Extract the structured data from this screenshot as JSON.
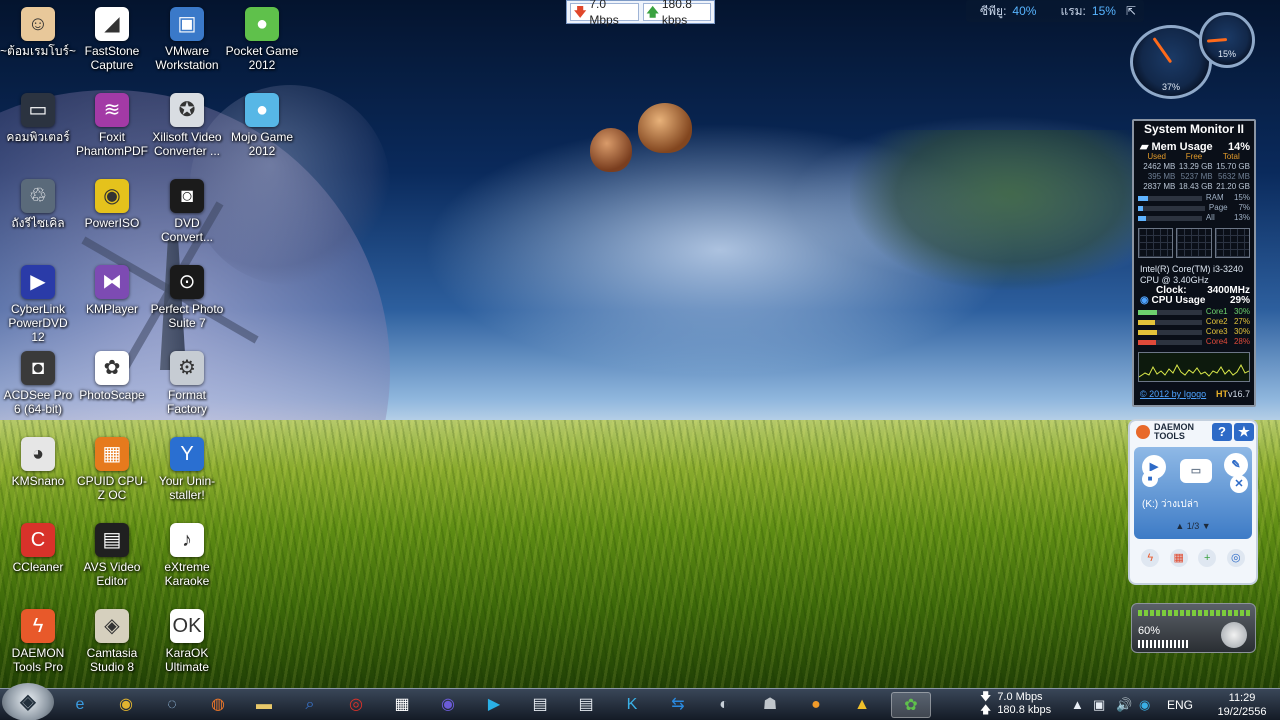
{
  "desktop": {
    "icons": [
      {
        "label": "~ต้อมเรมโบร์~",
        "icon": "user-avatar-icon",
        "bg": "#e8c89a",
        "glyph": "☺"
      },
      {
        "label": "FastStone Capture",
        "icon": "faststone-capture-icon",
        "bg": "#ffffff",
        "glyph": "◢"
      },
      {
        "label": "VMware Workstation",
        "icon": "vmware-icon",
        "bg": "#3a79c9",
        "glyph": "▣"
      },
      {
        "label": "Pocket Game 2012",
        "icon": "mushroom-icon",
        "bg": "#5fc14b",
        "glyph": "●"
      },
      {
        "label": "คอมพิวเตอร์",
        "icon": "computer-icon",
        "bg": "#2b3340",
        "glyph": "▭"
      },
      {
        "label": "Foxit PhantomPDF",
        "icon": "foxit-pdf-icon",
        "bg": "#a33aa6",
        "glyph": "≋"
      },
      {
        "label": "Xilisoft Video Converter ...",
        "icon": "film-reel-icon",
        "bg": "#d9dde2",
        "glyph": "✪"
      },
      {
        "label": "Mojo Game 2012",
        "icon": "mushroom-blue-icon",
        "bg": "#57b7e6",
        "glyph": "●"
      },
      {
        "label": "ถังรีไซเคิล",
        "icon": "recycle-bin-icon",
        "bg": "#5a6a7a",
        "glyph": "♲"
      },
      {
        "label": "PowerISO",
        "icon": "disc-icon",
        "bg": "#e5c21c",
        "glyph": "◉"
      },
      {
        "label": "DVD Convert...",
        "icon": "dvd-icon",
        "bg": "#1b1b1b",
        "glyph": "◙"
      },
      {
        "label": "CyberLink PowerDVD 12",
        "icon": "powerdvd-icon",
        "bg": "#2a3ba8",
        "glyph": "▶"
      },
      {
        "label": "KMPlayer",
        "icon": "kmplayer-icon",
        "bg": "#7d4bb3",
        "glyph": "⧓"
      },
      {
        "label": "Perfect Photo Suite 7",
        "icon": "on1-icon",
        "bg": "#1a1a1a",
        "glyph": "⊙"
      },
      {
        "label": "ACDSee Pro 6 (64-bit)",
        "icon": "camera-icon",
        "bg": "#3a3a3a",
        "glyph": "◘"
      },
      {
        "label": "PhotoScape",
        "icon": "photoscape-icon",
        "bg": "#ffffff",
        "glyph": "✿"
      },
      {
        "label": "Format Factory",
        "icon": "format-factory-icon",
        "bg": "#c6ccd3",
        "glyph": "⚙"
      },
      {
        "label": "KMSnano",
        "icon": "kmsnano-icon",
        "bg": "#e6e6e6",
        "glyph": "◕"
      },
      {
        "label": "CPUID CPU-Z OC",
        "icon": "cpuz-icon",
        "bg": "#e67a1d",
        "glyph": "▦"
      },
      {
        "label": "Your Unin-staller!",
        "icon": "uninstaller-icon",
        "bg": "#2a6fd1",
        "glyph": "Y"
      },
      {
        "label": "CCleaner",
        "icon": "ccleaner-icon",
        "bg": "#d8322a",
        "glyph": "C"
      },
      {
        "label": "AVS Video Editor",
        "icon": "avs-video-icon",
        "bg": "#202020",
        "glyph": "▤"
      },
      {
        "label": "eXtreme Karaoke",
        "icon": "karaoke-icon",
        "bg": "#ffffff",
        "glyph": "♪"
      },
      {
        "label": "DAEMON Tools Pro",
        "icon": "daemon-tools-icon",
        "bg": "#e8592a",
        "glyph": "ϟ"
      },
      {
        "label": "Camtasia Studio 8",
        "icon": "camtasia-icon",
        "bg": "#d6d0be",
        "glyph": "◈"
      },
      {
        "label": "KaraOK Ultimate",
        "icon": "karaok-icon",
        "bg": "#ffffff",
        "glyph": "OK"
      }
    ]
  },
  "net_meter": {
    "down": "7.0 Mbps",
    "up": "180.8 kbps"
  },
  "cpu_strip": {
    "cpu_label": "ซีพียู:",
    "cpu_value": "40%",
    "ram_label": "แรม:",
    "ram_value": "15%"
  },
  "gauges": {
    "big_value": "37%",
    "small_value": "15%",
    "big_level": 0.37,
    "small_level": 0.15
  },
  "system_monitor": {
    "title": "System Monitor II",
    "mem_label": "Mem Usage",
    "mem_value": "14%",
    "headers": [
      "Used",
      "Free",
      "Total"
    ],
    "rows": [
      [
        "2462 MB",
        "13.29 GB",
        "15.70 GB"
      ],
      [
        "395 MB",
        "5237 MB",
        "5632 MB"
      ],
      [
        "2837 MB",
        "18.43 GB",
        "21.20 GB"
      ]
    ],
    "bars": [
      {
        "label": "RAM",
        "value": "15%",
        "level": 0.15
      },
      {
        "label": "Page",
        "value": "7%",
        "level": 0.07
      },
      {
        "label": "All",
        "value": "13%",
        "level": 0.13
      }
    ],
    "cpu_name": "Intel(R) Core(TM) i3-3240",
    "cpu_speed": "CPU @ 3.40GHz",
    "clock_label": "Clock:",
    "clock_value": "3400MHz",
    "cpu_usage_label": "CPU Usage",
    "cpu_usage_value": "29%",
    "cores": [
      {
        "label": "Core1",
        "value": "30%",
        "level": 0.3,
        "color": "#6ed16e"
      },
      {
        "label": "Core2",
        "value": "27%",
        "level": 0.27,
        "color": "#e3c33a"
      },
      {
        "label": "Core3",
        "value": "30%",
        "level": 0.3,
        "color": "#e3c33a"
      },
      {
        "label": "Core4",
        "value": "28%",
        "level": 0.28,
        "color": "#e04a3a"
      }
    ],
    "footer_link": "© 2012 by Igogo",
    "footer_ht": "HT",
    "footer_version": "v16.7"
  },
  "daemon_tools": {
    "brand_line1": "DAEMON",
    "brand_line2": "TOOLS",
    "help": "?",
    "drive": "(K:) ว่างเปล่า",
    "page": "1/3"
  },
  "volume": {
    "level_text": "60%",
    "level": 0.6
  },
  "taskbar": {
    "items": [
      {
        "icon": "internet-explorer-icon",
        "glyph": "e",
        "color": "#3a9be0"
      },
      {
        "icon": "chrome-icon",
        "glyph": "◉",
        "color": "#e0b330"
      },
      {
        "icon": "network-globe-icon",
        "glyph": "◌",
        "color": "#9ec6ea"
      },
      {
        "icon": "firefox-icon",
        "glyph": "◍",
        "color": "#e8752a"
      },
      {
        "icon": "folder-icon",
        "glyph": "▬",
        "color": "#e8c86a"
      },
      {
        "icon": "search-tool-icon",
        "glyph": "⌕",
        "color": "#3a78d6"
      },
      {
        "icon": "burn-icon",
        "glyph": "◎",
        "color": "#d8322a"
      },
      {
        "icon": "calendar-icon",
        "glyph": "▦",
        "color": "#ffffff"
      },
      {
        "icon": "powerdvd-taskbar-icon",
        "glyph": "◉",
        "color": "#6b5bd6"
      },
      {
        "icon": "media-player-icon",
        "glyph": "▶",
        "color": "#2ab0e6"
      },
      {
        "icon": "clapper-icon",
        "glyph": "▤",
        "color": "#e3e8ee"
      },
      {
        "icon": "clapper-2-icon",
        "glyph": "▤",
        "color": "#e3e8ee"
      },
      {
        "icon": "k-app-icon",
        "glyph": "K",
        "color": "#3ab0e6"
      },
      {
        "icon": "teamviewer-icon",
        "glyph": "⇆",
        "color": "#2a8ae0"
      },
      {
        "icon": "disk-tool-icon",
        "glyph": "◐",
        "color": "#c8d0d8"
      },
      {
        "icon": "virus-scan-icon",
        "glyph": "☗",
        "color": "#c0c6cc"
      },
      {
        "icon": "orange-app-icon",
        "glyph": "●",
        "color": "#f09a2a"
      },
      {
        "icon": "warning-app-icon",
        "glyph": "▲",
        "color": "#f0c02a"
      },
      {
        "icon": "gadget-icon",
        "glyph": "✿",
        "color": "#5fc14b"
      }
    ]
  },
  "tray": {
    "down": "7.0 Mbps",
    "up": "180.8 kbps",
    "lang": "ENG",
    "time": "11:29",
    "date": "19/2/2556"
  }
}
